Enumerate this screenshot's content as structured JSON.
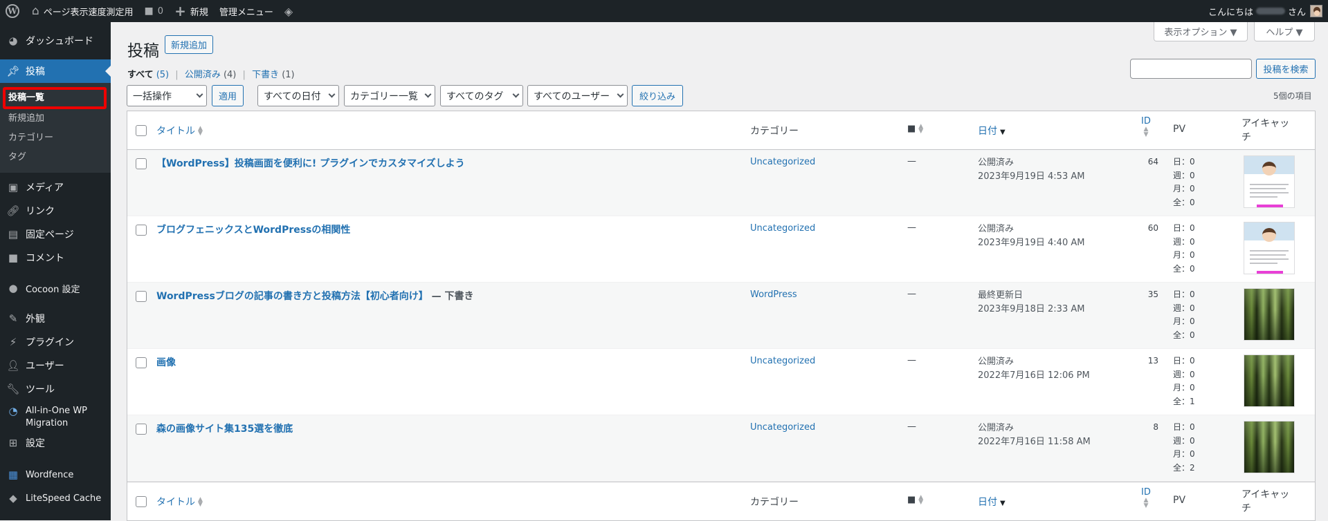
{
  "adminbar": {
    "site_name": "ページ表示速度測定用",
    "comments_count": "0",
    "new_label": "新規",
    "admin_menu_label": "管理メニュー",
    "greeting": "こんにちは",
    "greeting_suffix": "さん"
  },
  "sidebar": {
    "dashboard": "ダッシュボード",
    "posts": "投稿",
    "submenu": [
      "投稿一覧",
      "新規追加",
      "カテゴリー",
      "タグ"
    ],
    "media": "メディア",
    "links": "リンク",
    "pages": "固定ページ",
    "comments": "コメント",
    "cocoon": "Cocoon 設定",
    "appearance": "外観",
    "plugins": "プラグイン",
    "users": "ユーザー",
    "tools": "ツール",
    "aiowp_line1": "All-in-One WP",
    "aiowp_line2": "Migration",
    "settings": "設定",
    "wordfence": "Wordfence",
    "litespeed": "LiteSpeed Cache"
  },
  "header": {
    "title": "投稿",
    "add_new": "新規追加",
    "screen_options": "表示オプション ▼",
    "help": "ヘルプ ▼"
  },
  "views": {
    "all": "すべて",
    "all_count": "(5)",
    "published": "公開済み",
    "published_count": "(4)",
    "draft": "下書き",
    "draft_count": "(1)",
    "sep": "|"
  },
  "search": {
    "value": "",
    "button": "投稿を検索"
  },
  "filters": {
    "bulk": "一括操作",
    "apply": "適用",
    "dates": "すべての日付",
    "categories": "カテゴリー一覧",
    "tags": "すべてのタグ",
    "users": "すべてのユーザー",
    "filter": "絞り込み",
    "items_count": "5個の項目"
  },
  "columns": {
    "title": "タイトル",
    "category": "カテゴリー",
    "date": "日付",
    "id": "ID",
    "pv": "PV",
    "eyecatch_1": "アイキャッ",
    "eyecatch_2": "チ"
  },
  "rows": [
    {
      "title": "【WordPress】投稿画面を便利に! プラグインでカスタマイズしよう",
      "draft": "",
      "category": "Uncategorized",
      "comments": "—",
      "status": "公開済み",
      "date": "2023年9月19日 4:53 AM",
      "id": "64",
      "pv": [
        "日：0",
        "週：0",
        "月：0",
        "全：0"
      ],
      "thumb": "blog"
    },
    {
      "title": "ブログフェニックスとWordPressの相関性",
      "draft": "",
      "category": "Uncategorized",
      "comments": "—",
      "status": "公開済み",
      "date": "2023年9月19日 4:40 AM",
      "id": "60",
      "pv": [
        "日：0",
        "週：0",
        "月：0",
        "全：0"
      ],
      "thumb": "blog"
    },
    {
      "title": "WordPressブログの記事の書き方と投稿方法【初心者向け】",
      "draft": " — 下書き",
      "category": "WordPress",
      "comments": "—",
      "status": "最終更新日",
      "date": "2023年9月18日 2:33 AM",
      "id": "35",
      "pv": [
        "日：0",
        "週：0",
        "月：0",
        "全：0"
      ],
      "thumb": "forest"
    },
    {
      "title": "画像",
      "draft": "",
      "category": "Uncategorized",
      "comments": "—",
      "status": "公開済み",
      "date": "2022年7月16日 12:06 PM",
      "id": "13",
      "pv": [
        "日：0",
        "週：0",
        "月：0",
        "全：1"
      ],
      "thumb": "forest"
    },
    {
      "title": "森の画像サイト集135選を徹底",
      "draft": "",
      "category": "Uncategorized",
      "comments": "—",
      "status": "公開済み",
      "date": "2022年7月16日 11:58 AM",
      "id": "8",
      "pv": [
        "日：0",
        "週：0",
        "月：0",
        "全：2"
      ],
      "thumb": "forest"
    }
  ]
}
